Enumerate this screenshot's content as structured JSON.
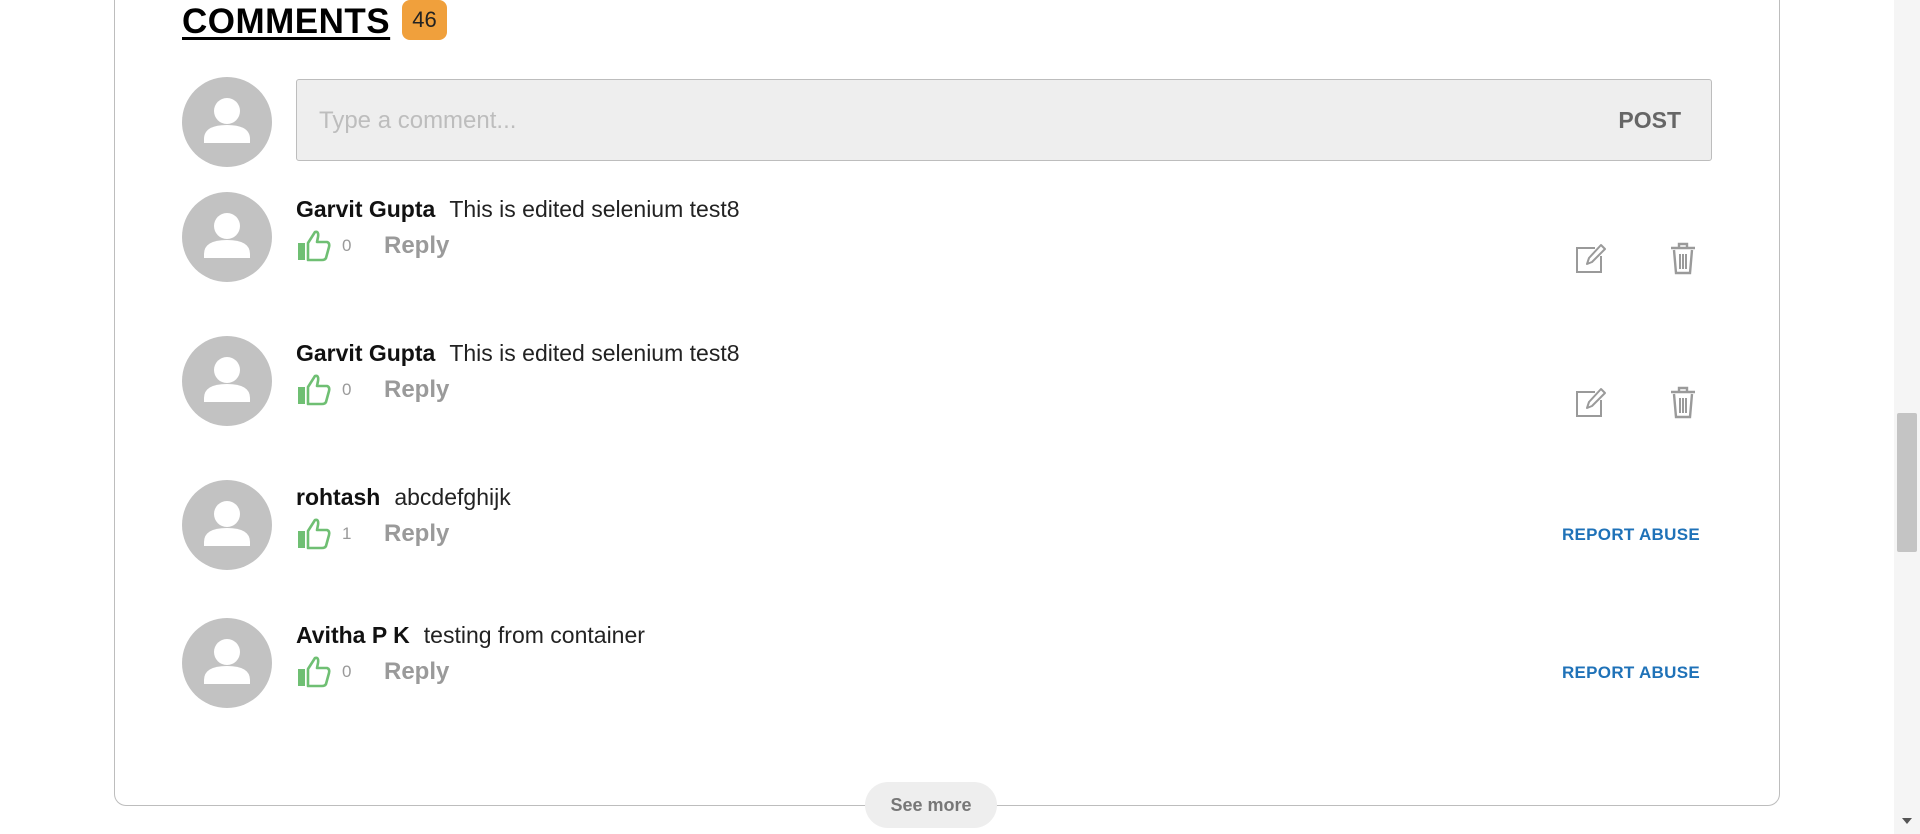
{
  "header": {
    "title": "COMMENTS",
    "count": "46"
  },
  "composer": {
    "placeholder": "Type a comment...",
    "post_label": "POST"
  },
  "comments": [
    {
      "author": "Garvit Gupta",
      "text": "This is edited selenium test8",
      "likes": "0",
      "reply_label": "Reply",
      "actions": [
        "edit-icon",
        "delete-icon"
      ]
    },
    {
      "author": "Garvit Gupta",
      "text": "This is edited selenium test8",
      "likes": "0",
      "reply_label": "Reply",
      "actions": [
        "edit-icon",
        "delete-icon"
      ]
    },
    {
      "author": "rohtash",
      "text": "abcdefghijk",
      "likes": "1",
      "reply_label": "Reply",
      "report_label": "REPORT ABUSE"
    },
    {
      "author": "Avitha P K",
      "text": "testing from container",
      "likes": "0",
      "reply_label": "Reply",
      "report_label": "REPORT ABUSE"
    }
  ],
  "footer": {
    "see_more_label": "See more"
  },
  "colors": {
    "accent_badge": "#f0a03c",
    "like_green": "#6fbf73",
    "report_blue": "#1f72b8",
    "avatar_gray": "#c2c2c2"
  }
}
